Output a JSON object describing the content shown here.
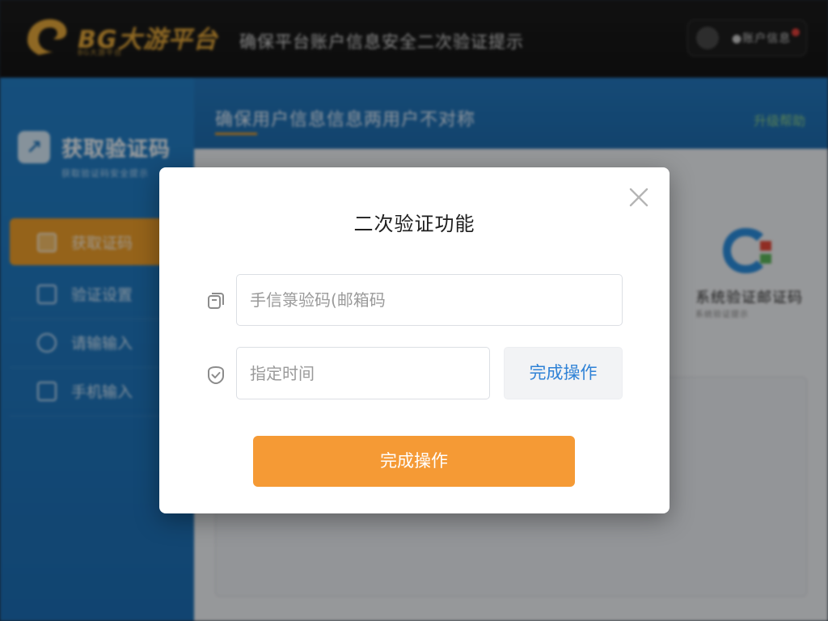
{
  "header": {
    "brand_name": "BG大游平台",
    "brand_tagline": "BG大游平台",
    "headline": "确保平台账户信息安全二次验证提示",
    "user_label": "●账户信息",
    "notification_color": "#e5403a"
  },
  "sidebar": {
    "title": "获取验证码",
    "subtitle": "获取验证码安全提示",
    "items": [
      {
        "label": "获取证码",
        "icon": "mailbox-icon",
        "active": true
      },
      {
        "label": "验证设置",
        "icon": "id-card-icon",
        "active": false
      },
      {
        "label": "请输输入",
        "icon": "shield-icon",
        "active": false
      },
      {
        "label": "手机输入",
        "icon": "phone-icon",
        "active": false
      }
    ]
  },
  "content": {
    "title": "确保用户信息信息两用户不对称",
    "link": "升级帮助",
    "panel_title": "系统验证邮证码",
    "panel_subtitle": "系统验证提示"
  },
  "modal": {
    "title": "二次验证功能",
    "code_input": {
      "placeholder": "手信箓验码(邮箱码",
      "icon": "copy-document-icon"
    },
    "time_input": {
      "placeholder": "指定时间",
      "icon": "shield-check-icon"
    },
    "code_button_label": "完成操作",
    "submit_label": "完成操作",
    "close_icon": "close-icon"
  },
  "colors": {
    "accent_orange": "#f59a35",
    "sidebar_blue": "#2380c9",
    "link_blue": "#2f82d6"
  }
}
